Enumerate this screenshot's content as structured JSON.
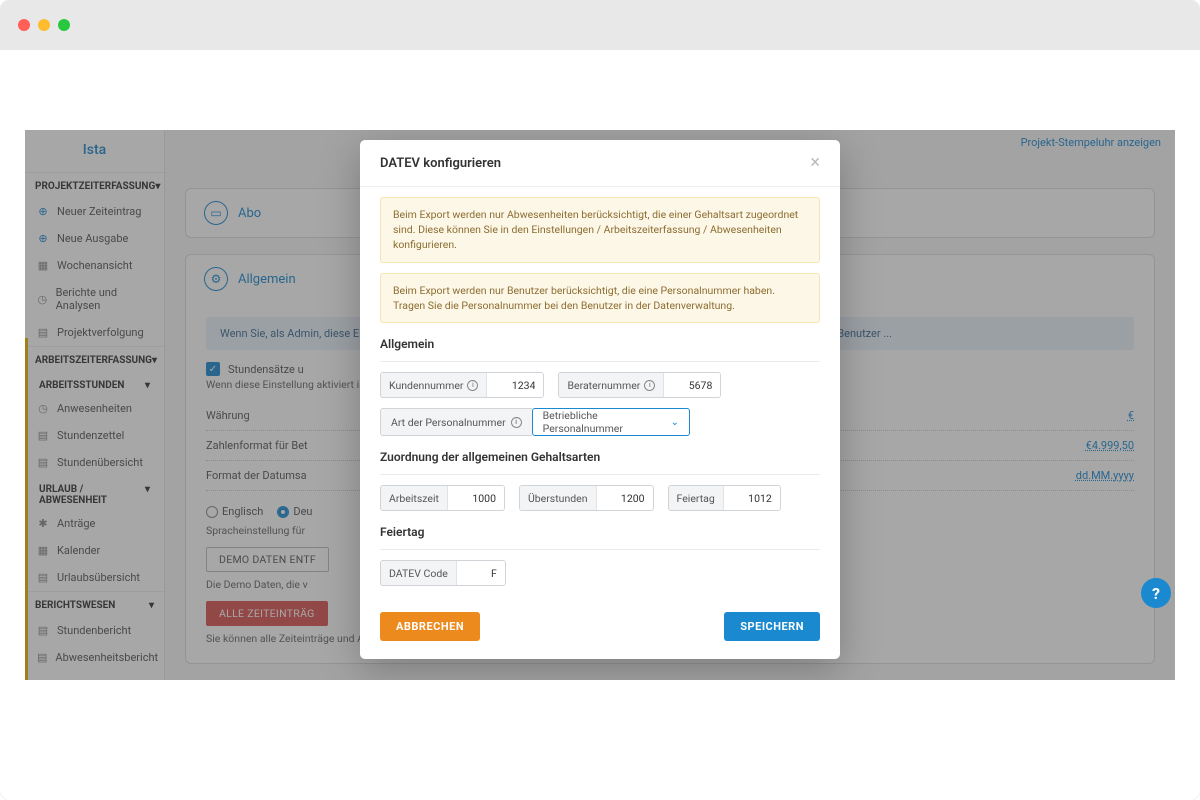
{
  "brand": "Ista",
  "topbar": {
    "stopwatch": "Projekt-Stempeluhr anzeigen"
  },
  "sidebar": {
    "sec1": "PROJEKTZEITERFASSUNG",
    "items1": [
      {
        "label": "Neuer Zeiteintrag"
      },
      {
        "label": "Neue Ausgabe"
      },
      {
        "label": "Wochenansicht"
      },
      {
        "label": "Berichte und Analysen"
      },
      {
        "label": "Projektverfolgung"
      }
    ],
    "sec2": "ARBEITSZEITERFASSUNG",
    "sub2a": "ARBEITSSTUNDEN",
    "items2a": [
      "Anwesenheiten",
      "Stundenzettel",
      "Stundenübersicht"
    ],
    "sub2b": "URLAUB / ABWESENHEIT",
    "items2b": [
      "Anträge",
      "Kalender",
      "Urlaubsübersicht"
    ],
    "sec3": "BERICHTSWESEN",
    "items3": [
      "Stundenbericht",
      "Abwesenheitsbericht"
    ]
  },
  "main": {
    "abo_title": "Abo",
    "allgemein_title": "Allgemein",
    "info_band": "Wenn Sie, als Admin, diese Einstellungen ändern, betrifft das alle Benutzer. In der mobilen App oder in der Web-App können die Benutzer ...",
    "chk_label": "Stundensätze u",
    "chk_sub": "Wenn diese Einstellung aktiviert ist, können die Benutzer für jede Zeitbuchung einen Stundensatz oder Pauschalbetrag eingeb",
    "kv": [
      {
        "k": "Währung",
        "v": "€"
      },
      {
        "k": "Zahlenformat für Bet",
        "v": "€4.999,50"
      },
      {
        "k": "Format der Datumsa",
        "v": "dd.MM.yyyy"
      }
    ],
    "lang": {
      "en": "Englisch",
      "de": "Deu",
      "hint": "Spracheinstellung für"
    },
    "demo_btn": "DEMO DATEN ENTF",
    "demo_hint": "Die Demo Daten, die v",
    "del_btn": "ALLE ZEITEINTRÄG",
    "del_hint": "Sie können alle Zeiteinträge und Ausgaben für alle Benutzer entfernen. Diese Daten können Sie dann nicht mehr wiederherstellen."
  },
  "modal": {
    "title": "DATEV konfigurieren",
    "warn1": "Beim Export werden nur Abwesenheiten berücksichtigt, die einer Gehaltsart zugeordnet sind.\nDiese können Sie in den Einstellungen / Arbeitszeiterfassung / Abwesenheiten konfigurieren.",
    "warn2": "Beim Export werden nur Benutzer berücksichtigt, die eine Personalnummer haben.\nTragen Sie die Personalnummer bei den Benutzer in der Datenverwaltung.",
    "sec_allgemein": "Allgemein",
    "kundennummer_label": "Kundennummer",
    "kundennummer_value": "1234",
    "beraternummer_label": "Beraternummer",
    "beraternummer_value": "5678",
    "persnr_label": "Art der Personalnummer",
    "persnr_value": "Betriebliche Personalnummer",
    "sec_zuordnung": "Zuordnung der allgemeinen Gehaltsarten",
    "arbeitszeit_label": "Arbeitszeit",
    "arbeitszeit_value": "1000",
    "ueberstunden_label": "Überstunden",
    "ueberstunden_value": "1200",
    "feiertag_assign_label": "Feiertag",
    "feiertag_assign_value": "1012",
    "sec_feiertag": "Feiertag",
    "datev_code_label": "DATEV Code",
    "datev_code_value": "F",
    "abort": "ABBRECHEN",
    "save": "SPEICHERN"
  },
  "help": "?"
}
